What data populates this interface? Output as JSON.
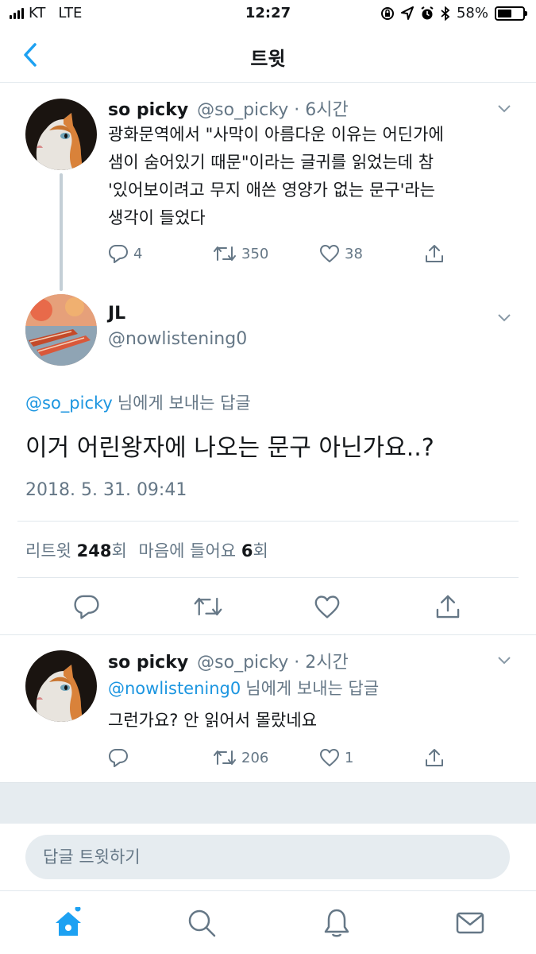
{
  "status_bar": {
    "carrier": "KT",
    "network": "LTE",
    "time": "12:27",
    "battery_percent": "58%",
    "battery_level": 0.58
  },
  "header": {
    "title": "트윗",
    "back_icon": "chevron-left-icon"
  },
  "parent_tweet": {
    "display_name": "so picky",
    "handle": "@so_picky",
    "time_ago": "6시간",
    "text_lines": [
      "광화문역에서 \"사막이 아름다운 이유는 어딘가에",
      "샘이 숨어있기 때문\"이라는 글귀를 읽었는데 참",
      "'있어보이려고 무지 애쓴 영양가 없는 문구'라는",
      "생각이 들었다"
    ],
    "replies": "4",
    "retweets": "350",
    "likes": "38"
  },
  "main_tweet": {
    "display_name": "JL",
    "handle": "@nowlistening0",
    "reply_to_handle": "@so_picky",
    "reply_to_suffix": "님에게 보내는 답글",
    "text": "이거 어린왕자에 나오는 문구 아닌가요..?",
    "timestamp": "2018. 5. 31. 09:41",
    "retweet_label": "리트윗",
    "retweet_count": "248",
    "count_unit": "회",
    "like_label": "마음에 들어요",
    "like_count": "6"
  },
  "reply_tweet": {
    "display_name": "so picky",
    "handle": "@so_picky",
    "time_ago": "2시간",
    "reply_to_handle": "@nowlistening0",
    "reply_to_suffix": "님에게 보내는 답글",
    "text": "그런가요? 안 읽어서 몰랐네요",
    "retweets": "206",
    "likes": "1"
  },
  "compose": {
    "placeholder": "답글 트윗하기"
  },
  "colors": {
    "accent": "#1da1f2",
    "link": "#1b95e0",
    "muted": "#657786"
  }
}
